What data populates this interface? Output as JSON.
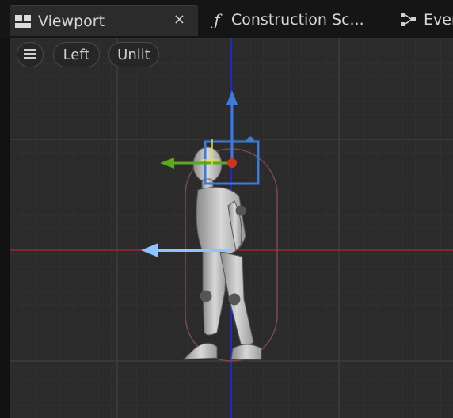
{
  "tabs": [
    {
      "label": "Viewport",
      "icon": "viewport-icon",
      "active": true
    },
    {
      "label": "Construction Sc...",
      "icon": "function-icon",
      "active": false
    },
    {
      "label": "Even",
      "icon": "graph-icon",
      "active": false
    }
  ],
  "close_glyph": "×",
  "function_glyph": "ƒ",
  "toolbar": {
    "menu_icon": "hamburger-icon",
    "view_mode": "Left",
    "lighting_mode": "Unlit"
  },
  "colors": {
    "grid_bg": "#2b2b2b",
    "axis_red": "#9b2a2a",
    "axis_blue": "#1f2bbf",
    "gizmo_blue": "#3d7bd8",
    "gizmo_green": "#5ca81e",
    "arrow_light_blue": "#8fc4ff",
    "capsule": "#7a4a4a"
  }
}
